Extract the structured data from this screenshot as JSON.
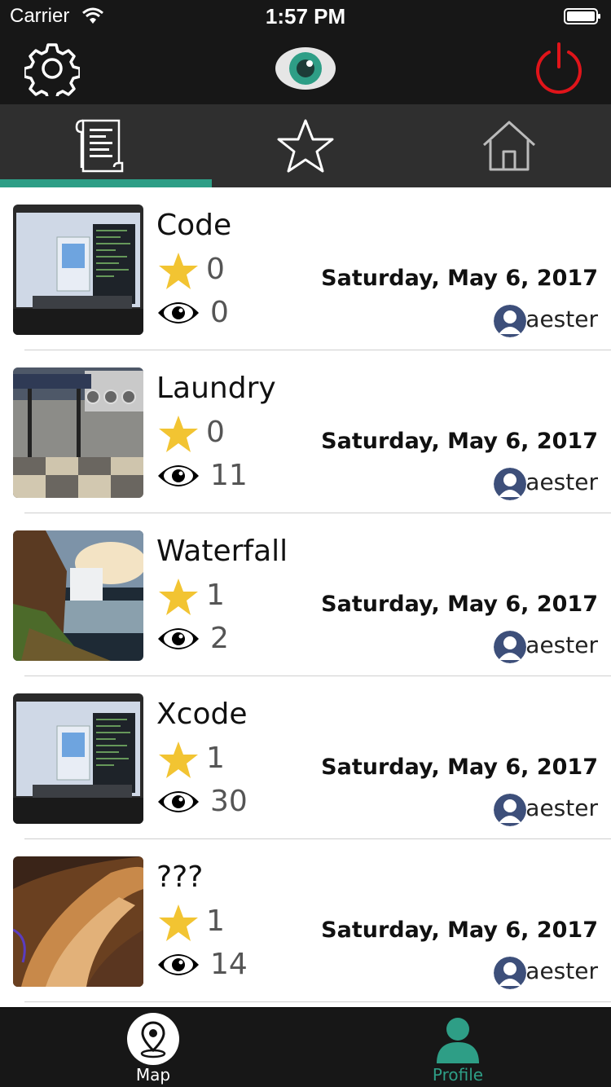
{
  "status_bar": {
    "carrier": "Carrier",
    "time": "1:57 PM"
  },
  "colors": {
    "accent": "#2e9e86",
    "power": "#e0141a",
    "star": "#f2c432",
    "bar": "#171717",
    "tab_bar": "#2f2f2f"
  },
  "nav": {
    "left_icon": "gear-icon",
    "center_icon": "eye-logo-icon",
    "right_icon": "power-icon"
  },
  "tabs": [
    {
      "name": "posts",
      "icon": "scroll-icon",
      "selected": true
    },
    {
      "name": "favorites",
      "icon": "star-outline-icon",
      "selected": false
    },
    {
      "name": "home",
      "icon": "house-icon",
      "selected": false
    }
  ],
  "posts": [
    {
      "title": "Code",
      "stars": "0",
      "views": "0",
      "date": "Saturday, May 6, 2017",
      "author": "aester"
    },
    {
      "title": "Laundry",
      "stars": "0",
      "views": "11",
      "date": "Saturday, May 6, 2017",
      "author": "aester"
    },
    {
      "title": "Waterfall",
      "stars": "1",
      "views": "2",
      "date": "Saturday, May 6, 2017",
      "author": "aester"
    },
    {
      "title": "Xcode",
      "stars": "1",
      "views": "30",
      "date": "Saturday, May 6, 2017",
      "author": "aester"
    },
    {
      "title": "???",
      "stars": "1",
      "views": "14",
      "date": "Saturday, May 6, 2017",
      "author": "aester"
    }
  ],
  "bottom_bar": {
    "map_label": "Map",
    "profile_label": "Profile",
    "selected": "Profile"
  }
}
